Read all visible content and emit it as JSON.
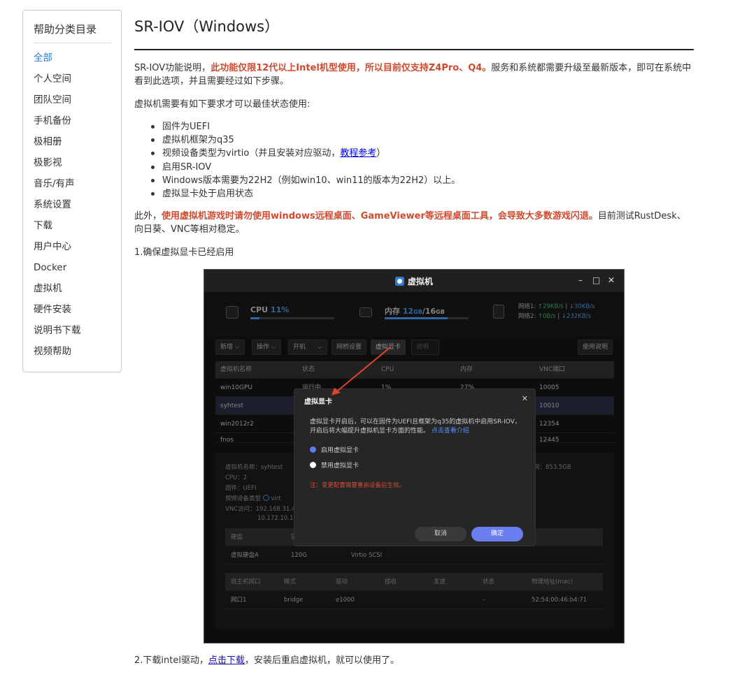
{
  "sidebar": {
    "title": "帮助分类目录",
    "items": [
      "全部",
      "个人空间",
      "团队空间",
      "手机备份",
      "极相册",
      "极影视",
      "音乐/有声",
      "系统设置",
      "下载",
      "用户中心",
      "Docker",
      "虚拟机",
      "硬件安装",
      "说明书下载",
      "视频帮助"
    ]
  },
  "page": {
    "title": "SR-IOV（Windows）",
    "intro_pre": "SR-IOV功能说明，",
    "intro_red": "此功能仅限12代以上Intel机型使用，所以目前仅支持Z4Pro、Q4。",
    "intro_post": "服务和系统都需要升级至最新版本，即可在系统中看到此选项，并且需要经过如下步骤。",
    "req_heading": "虚拟机需要有如下要求才可以最佳状态使用:",
    "requirements": {
      "r1": "固件为UEFI",
      "r2": "虚拟机框架为q35",
      "r3_pre": "视频设备类型为virtio（并且安装对应驱动，",
      "r3_link": "教程参考",
      "r3_post": "）",
      "r4": "启用SR-IOV",
      "r5": "Windows版本需要为22H2（例如win10、win11的版本为22H2）以上。",
      "r6": "虚拟显卡处于启用状态"
    },
    "warn_pre": "此外，",
    "warn_red": "使用虚拟机游戏时请勿使用windows远程桌面、GameViewer等远程桌面工具，会导致大多数游戏闪退。",
    "warn_post": "目前测试RustDesk、向日葵、VNC等相对稳定。",
    "step1": "1.确保虚拟显卡已经启用",
    "step2_pre": "2.下载intel驱动，",
    "step2_link": "点击下载",
    "step2_post": "，安装后重启虚拟机，就可以使用了。"
  },
  "shot": {
    "window_title": "虚拟机",
    "controls": {
      "min": "–",
      "max": "□",
      "close": "✕"
    },
    "cpu_label": "CPU",
    "cpu_value": "11%",
    "cpu_fill": 0.11,
    "mem_label": "内存",
    "mem_used": "12",
    "mem_used_unit": "GB",
    "mem_sep": "/",
    "mem_total": "16",
    "mem_total_unit": "GB",
    "mem_fill": 0.75,
    "net1_label": "网络1:",
    "net1_up": "↑29KB/s",
    "net1_down": "↓30KB/s",
    "net2_label": "网络2:",
    "net2_up": "↑0B/s",
    "net2_down": "↓232KB/s",
    "toolbar": {
      "new": "新增 ⌵",
      "ops": "操作 ⌵",
      "power": "开机",
      "power_arrow": "⌵",
      "net": "网桥设置",
      "vgpu": "虚拟显卡",
      "help": "说明",
      "manual": "使用说明"
    },
    "vm_headers": {
      "name": "虚拟机名称",
      "status": "状态",
      "cpu": "CPU",
      "mem": "内存",
      "vnc": "VNC端口"
    },
    "vms": [
      {
        "name": "win10GPU",
        "status": "运行中",
        "cpu": "1%",
        "mem": "27%",
        "vnc": "10005"
      },
      {
        "name": "syhtest",
        "status": "",
        "cpu": "",
        "mem": "",
        "vnc": "10010"
      },
      {
        "name": "win2012r2",
        "status": "",
        "cpu": "",
        "mem": "",
        "vnc": "12354"
      },
      {
        "name": "fnos",
        "status": "",
        "cpu": "",
        "mem": "",
        "vnc": "12445"
      }
    ],
    "detail": {
      "name": "虚拟机名称：syhtest",
      "cpu": "CPU：2",
      "fw": "固件：UEFI",
      "video": "视频设备类型",
      "video_val": "virt",
      "vnc": "VNC访问：192.168.31.4",
      "vnc2": "10.172.10.1",
      "space": "间：853.5GB"
    },
    "disk_headers": {
      "disk": "硬盘",
      "col2": "容"
    },
    "disk_row": {
      "name": "虚拟硬盘A",
      "size": "120G",
      "bus": "Virtio SCSI"
    },
    "net_headers": {
      "port": "宿主机网口",
      "mode": "模式",
      "driver": "驱动",
      "rx": "接收",
      "tx": "发送",
      "status": "状态",
      "mac": "物理地址(mac)"
    },
    "net_row": {
      "port": "网口1",
      "mode": "bridge",
      "driver": "e1000",
      "status": "-",
      "mac": "52:54:00:46:b4:71"
    },
    "modal": {
      "title": "虚拟显卡",
      "close": "✕",
      "text_pre": "虚拟显卡开启后，可以在固件为UEFI且框架为q35的虚拟机中启用SR-IOV，开启后将大幅提升虚拟机显卡方面的性能。",
      "text_link": "点击查看介绍",
      "opt_on": "启用虚拟显卡",
      "opt_off": "禁用虚拟显卡",
      "note": "注：变更配置需要重启设备后生效。",
      "cancel": "取消",
      "ok": "确定"
    }
  },
  "colors": {
    "accent": "#2b7bd6",
    "red": "#d04a2f",
    "link": "#1a0dab"
  }
}
